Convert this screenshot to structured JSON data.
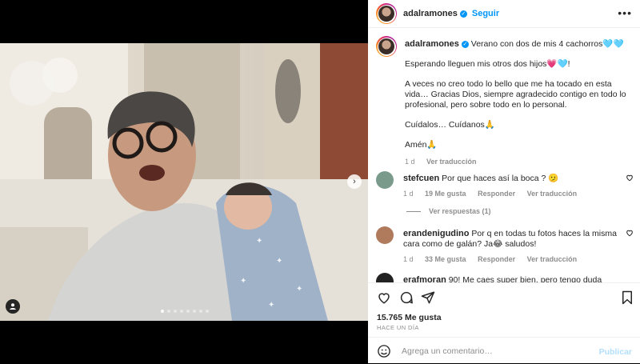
{
  "post": {
    "username": "adalramones",
    "follow_label": "Seguir",
    "more_label": "•••",
    "caption": {
      "username": "adalramones",
      "line1": "Verano con dos de mis 4 cachorros🩵🩵",
      "line2": "Esperando lleguen mis otros dos hijos💗🩵!",
      "line3": "A veces no creo todo lo bello que me ha tocado en esta vida… Gracias Dios, siempre agradecido contigo en todo lo profesional, pero sobre todo en lo personal.",
      "line4": "Cuídalos… Cuídanos🙏",
      "line5": "Amén🙏",
      "age": "1 d",
      "translate_label": "Ver traducción"
    },
    "comments": [
      {
        "username": "stefcuen",
        "text": "Por que haces así la boca ? 🫤",
        "age": "1 d",
        "likes": "19 Me gusta",
        "reply_label": "Responder",
        "translate_label": "Ver traducción",
        "avatar_color": "#7a9a8c"
      },
      {
        "username": "erandenigudino",
        "text": "Por q en todas tu fotos haces la misma cara como de galán? Ja😂 saludos!",
        "age": "1 d",
        "likes": "33 Me gusta",
        "reply_label": "Responder",
        "translate_label": "Ver traducción",
        "avatar_color": "#b07a5c"
      },
      {
        "username": "erafmoran",
        "text": "90! Me caes super bien, pero tengo duda",
        "avatar_color": "#222222"
      }
    ],
    "view_replies_label": "Ver respuestas (1)",
    "likes_count": "15.765 Me gusta",
    "timestamp": "HACE UN DÍA",
    "comment_placeholder": "Agrega un comentario…",
    "publish_label": "Publicar",
    "carousel": {
      "count": 8,
      "active_index": 0
    },
    "icons": [
      "heart-icon",
      "comment-icon",
      "share-icon",
      "bookmark-icon",
      "emoji-icon",
      "tag-user-icon",
      "chevron-right-icon",
      "verified-icon"
    ],
    "colors": {
      "accent": "#0095f6",
      "publish_disabled": "#b2dffc",
      "muted": "#8e8e8e"
    }
  }
}
